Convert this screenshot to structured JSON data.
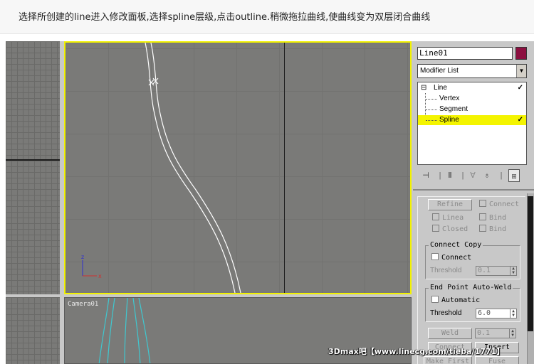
{
  "caption": "选择所创建的line进入修改面板,选择spline层级,点击outline.稍微拖拉曲线,使曲线变为双层闭合曲线",
  "viewports": {
    "camera_label": "Camera01",
    "axis_z": "z",
    "axis_x": "x"
  },
  "command_panel": {
    "object_name": "Line01",
    "object_color": "#8c1040",
    "modifier_list": "Modifier List",
    "stack": [
      {
        "label": "Line",
        "expander": "⊟",
        "selected": false
      },
      {
        "label": "Vertex",
        "selected": false
      },
      {
        "label": "Segment",
        "selected": false
      },
      {
        "label": "Spline",
        "selected": true
      }
    ],
    "toolbar_icons": [
      "pin-stack-icon",
      "show-end-result-icon",
      "make-unique-icon",
      "remove-modifier-icon",
      "configure-sets-icon"
    ]
  },
  "rollout": {
    "refine_label": "Refine",
    "connect_label": "Connect",
    "linear_label": "Linea",
    "bind_label_1": "Bind",
    "closed_label": "Closed",
    "bind_label_2": "Bind",
    "connect_copy": {
      "title": "Connect Copy",
      "connect_label": "Connect",
      "threshold_label": "Threshold",
      "threshold_value": "0.1"
    },
    "end_point_weld": {
      "title": "End Point Auto-Weld",
      "automatic_label": "Automatic",
      "threshold_label": "Threshold",
      "threshold_value": "6.0"
    },
    "weld_label": "Weld",
    "weld_value": "0.1",
    "connect_btn_label": "Connect",
    "insert_label": "Insert",
    "make_first_label": "Make First",
    "fuse_label": "Fuse"
  },
  "watermark": "3Dmax吧【www.linecg.com/tieba/1771】",
  "colors": {
    "viewport_bg": "#7a7a78",
    "active_border": "#f2f200",
    "selection": "#f4f400",
    "spline": "#ffffff",
    "camera_spline": "#3fc8d0"
  }
}
